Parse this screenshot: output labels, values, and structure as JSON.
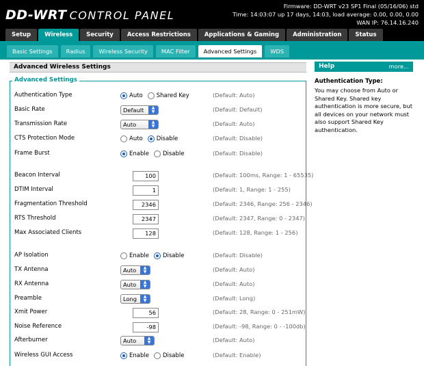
{
  "header": {
    "logo_dd": "DD-WRT",
    "logo_cp": "CONTROL PANEL",
    "firmware": "Firmware: DD-WRT v23 SP1 Final (05/16/06) std",
    "time": "Time: 14:03:07 up 17 days, 14:03, load average: 0.00, 0.00, 0.00",
    "wan_ip": "WAN IP: 76.14.16.240"
  },
  "main_tabs": [
    {
      "label": "Setup"
    },
    {
      "label": "Wireless"
    },
    {
      "label": "Security"
    },
    {
      "label": "Access Restrictions"
    },
    {
      "label": "Applications & Gaming"
    },
    {
      "label": "Administration"
    },
    {
      "label": "Status"
    }
  ],
  "sub_tabs": [
    {
      "label": "Basic Settings"
    },
    {
      "label": "Radius"
    },
    {
      "label": "Wireless Security"
    },
    {
      "label": "MAC Filter"
    },
    {
      "label": "Advanced Settings"
    },
    {
      "label": "WDS"
    }
  ],
  "section": {
    "title": "Advanced Wireless Settings",
    "legend": "Advanced Settings"
  },
  "rows": [
    {
      "label": "Authentication Type",
      "opt1": "Auto",
      "opt2": "Shared Key",
      "default": "(Default: Auto)"
    },
    {
      "label": "Basic Rate",
      "value": "Default",
      "default": "(Default: Default)"
    },
    {
      "label": "Transmission Rate",
      "value": "Auto",
      "default": "(Default: Auto)"
    },
    {
      "label": "CTS Protection Mode",
      "opt1": "Auto",
      "opt2": "Disable",
      "default": "(Default: Disable)"
    },
    {
      "label": "Frame Burst",
      "opt1": "Enable",
      "opt2": "Disable",
      "default": "(Default: Disable)"
    },
    {
      "label": "Beacon Interval",
      "value": "100",
      "default": "(Default: 100ms, Range: 1 - 65535)"
    },
    {
      "label": "DTIM Interval",
      "value": "1",
      "default": "(Default: 1, Range: 1 - 255)"
    },
    {
      "label": "Fragmentation Threshold",
      "value": "2346",
      "default": "(Default: 2346, Range: 256 - 2346)"
    },
    {
      "label": "RTS Threshold",
      "value": "2347",
      "default": "(Default: 2347, Range: 0 - 2347)"
    },
    {
      "label": "Max Associated Clients",
      "value": "128",
      "default": "(Default: 128, Range: 1 - 256)"
    },
    {
      "label": "AP Isolation",
      "opt1": "Enable",
      "opt2": "Disable",
      "default": "(Default: Disable)"
    },
    {
      "label": "TX Antenna",
      "value": "Auto",
      "default": "(Default: Auto)"
    },
    {
      "label": "RX Antenna",
      "value": "Auto",
      "default": "(Default: Auto)"
    },
    {
      "label": "Preamble",
      "value": "Long",
      "default": "(Default: Long)"
    },
    {
      "label": "Xmit Power",
      "value": "56",
      "default": "(Default: 28, Range: 0 - 251mW)"
    },
    {
      "label": "Noise Reference",
      "value": "-98",
      "default": "(Default: -98, Range: 0 - -100db)"
    },
    {
      "label": "Afterburner",
      "value": "Auto",
      "default": "(Default: Auto)"
    },
    {
      "label": "Wireless GUI Access",
      "opt1": "Enable",
      "opt2": "Disable",
      "default": "(Default: Enable)"
    }
  ],
  "help": {
    "title": "Help",
    "more": "more...",
    "heading": "Authentication Type:",
    "text": "You may choose from Auto or Shared Key. Shared key authentication is more secure, but all devices on your network must also support Shared Key authentication."
  },
  "colors": {
    "accent": "#009999",
    "select_arrow": "#3875d7"
  }
}
